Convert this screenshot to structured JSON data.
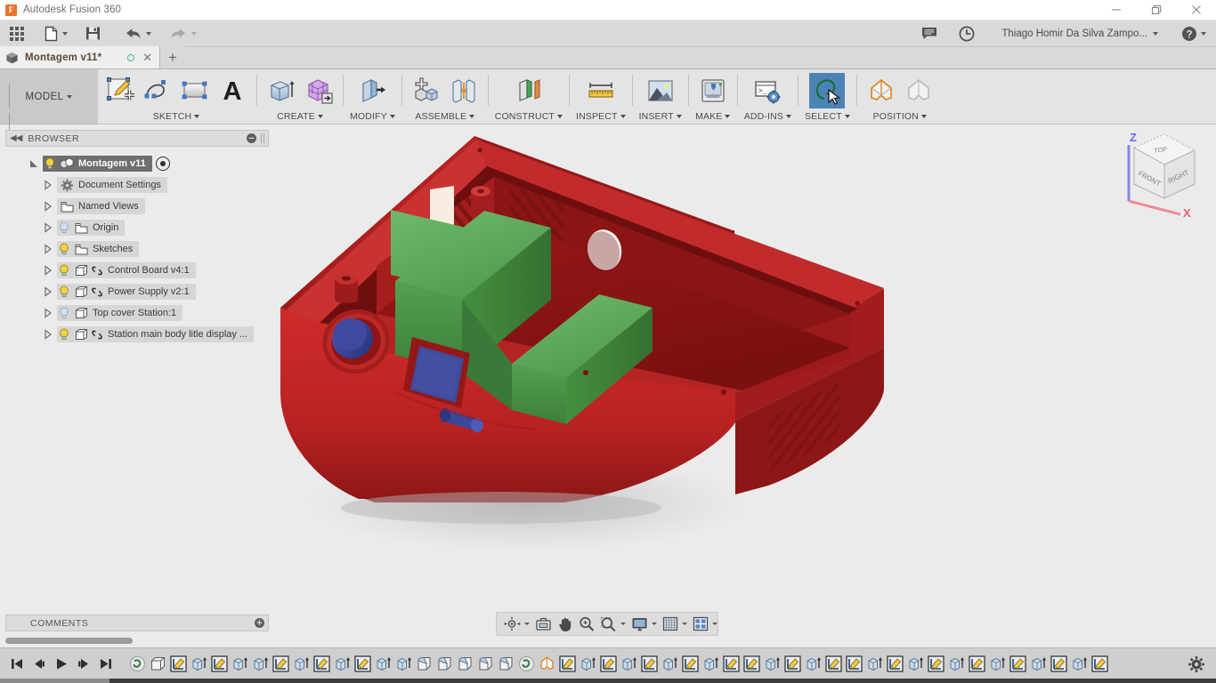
{
  "window": {
    "app_title": "Autodesk Fusion 360",
    "logo_letter": "F",
    "controls": {
      "minimize": "minimize-icon",
      "maximize": "restore-icon",
      "close": "close-icon"
    }
  },
  "quick_access": {
    "left_items": [
      {
        "name": "show-data-panel-button",
        "icon": "grid-icon",
        "label": "",
        "has_caret": false
      },
      {
        "name": "file-menu-button",
        "icon": "file-icon",
        "label": "",
        "has_caret": true
      },
      {
        "name": "save-button",
        "icon": "save-icon",
        "label": "",
        "has_caret": false
      },
      {
        "name": "undo-button",
        "icon": "undo-arrow-icon",
        "label": "",
        "has_caret": true
      },
      {
        "name": "redo-button",
        "icon": "redo-arrow-icon",
        "label": "",
        "has_caret": true
      }
    ],
    "right_items": [
      {
        "name": "comments-button",
        "icon": "speech-bubble-icon"
      },
      {
        "name": "job-status-button",
        "icon": "clock-icon"
      }
    ],
    "account_label": "Thiago Homir Da Silva Zampo...",
    "help_icon": "question-mark-icon"
  },
  "tabs": {
    "documents": [
      {
        "label": "Montagem v11*",
        "icon": "cube-icon",
        "modified_indicator": "circle",
        "close": "x",
        "active": true
      }
    ],
    "new_tab_label": "+"
  },
  "ribbon": {
    "workspace_label": "MODEL",
    "groups": [
      {
        "label": "SKETCH",
        "name": "ribbon-group-sketch",
        "tools": [
          {
            "name": "create-sketch-tool",
            "icon": "sketch-pencil-icon"
          },
          {
            "name": "spline-tool",
            "icon": "spline-curve-icon"
          },
          {
            "name": "rectangle-tool",
            "icon": "rectangle-icon"
          },
          {
            "name": "text-tool",
            "icon": "text-A-icon"
          }
        ]
      },
      {
        "label": "CREATE",
        "name": "ribbon-group-create",
        "tools": [
          {
            "name": "extrude-tool",
            "icon": "extrude-icon"
          },
          {
            "name": "create-form-tool",
            "icon": "form-mesh-icon"
          }
        ]
      },
      {
        "label": "MODIFY",
        "name": "ribbon-group-modify",
        "tools": [
          {
            "name": "press-pull-tool",
            "icon": "press-pull-icon"
          }
        ]
      },
      {
        "label": "ASSEMBLE",
        "name": "ribbon-group-assemble",
        "tools": [
          {
            "name": "new-component-tool",
            "icon": "new-component-icon"
          },
          {
            "name": "joint-tool",
            "icon": "joint-icon"
          }
        ]
      },
      {
        "label": "CONSTRUCT",
        "name": "ribbon-group-construct",
        "tools": [
          {
            "name": "offset-plane-tool",
            "icon": "offset-plane-icon"
          }
        ]
      },
      {
        "label": "INSPECT",
        "name": "ribbon-group-inspect",
        "tools": [
          {
            "name": "measure-tool",
            "icon": "ruler-icon"
          }
        ]
      },
      {
        "label": "INSERT",
        "name": "ribbon-group-insert",
        "tools": [
          {
            "name": "insert-mcmaster-tool",
            "icon": "picture-icon"
          }
        ]
      },
      {
        "label": "MAKE",
        "name": "ribbon-group-make",
        "tools": [
          {
            "name": "3d-print-tool",
            "icon": "3d-printer-icon"
          }
        ]
      },
      {
        "label": "ADD-INS",
        "name": "ribbon-group-addins",
        "tools": [
          {
            "name": "scripts-and-addins-tool",
            "icon": "console-gear-icon"
          }
        ]
      },
      {
        "label": "SELECT",
        "name": "ribbon-group-select",
        "tools": [
          {
            "name": "select-tool",
            "icon": "lasso-cursor-icon",
            "active": true
          }
        ]
      },
      {
        "label": "POSITION",
        "name": "ribbon-group-position",
        "tools": [
          {
            "name": "position-capture-tool",
            "icon": "position-orange-icon"
          },
          {
            "name": "position-revert-tool",
            "icon": "position-gray-icon"
          }
        ]
      }
    ]
  },
  "browser": {
    "panel_title": "BROWSER",
    "collapse_icon": "double-chevron-left-icon",
    "options_icon": "minus-circle-icon",
    "tree": [
      {
        "label": "Montagem v11",
        "depth": 0,
        "selected": true,
        "bulb": "on",
        "icon": "assembly-icon",
        "has_arrow": true,
        "arrow_open": true,
        "link": false,
        "radio": true
      },
      {
        "label": "Document Settings",
        "depth": 1,
        "selected": false,
        "bulb": "none",
        "icon": "gear-icon",
        "has_arrow": true,
        "arrow_open": false,
        "link": false,
        "radio": false
      },
      {
        "label": "Named Views",
        "depth": 1,
        "selected": false,
        "bulb": "none",
        "icon": "folder-icon",
        "has_arrow": true,
        "arrow_open": false,
        "link": false,
        "radio": false
      },
      {
        "label": "Origin",
        "depth": 1,
        "selected": false,
        "bulb": "off",
        "icon": "folder-icon",
        "has_arrow": true,
        "arrow_open": false,
        "link": false,
        "radio": false
      },
      {
        "label": "Sketches",
        "depth": 1,
        "selected": false,
        "bulb": "on",
        "icon": "folder-icon",
        "has_arrow": true,
        "arrow_open": false,
        "link": false,
        "radio": false
      },
      {
        "label": "Control Board v4:1",
        "depth": 1,
        "selected": false,
        "bulb": "on",
        "icon": "body-icon",
        "has_arrow": true,
        "arrow_open": false,
        "link": true,
        "radio": false
      },
      {
        "label": "Power Supply v2:1",
        "depth": 1,
        "selected": false,
        "bulb": "on",
        "icon": "body-icon",
        "has_arrow": true,
        "arrow_open": false,
        "link": true,
        "radio": false
      },
      {
        "label": "Top cover Station:1",
        "depth": 1,
        "selected": false,
        "bulb": "off",
        "icon": "body-icon",
        "has_arrow": true,
        "arrow_open": false,
        "link": false,
        "radio": false
      },
      {
        "label": "Station main body litle display ...",
        "depth": 1,
        "selected": false,
        "bulb": "on",
        "icon": "body-icon",
        "has_arrow": true,
        "arrow_open": false,
        "link": true,
        "radio": false
      }
    ]
  },
  "comments_panel": {
    "title": "COMMENTS",
    "add_icon": "plus-circle-icon"
  },
  "viewcube": {
    "faces": {
      "top": "TOP",
      "front": "FRONT",
      "right": "RIGHT"
    },
    "axes": {
      "z": "Z",
      "x": "X"
    },
    "axis_colors": {
      "z": "#7b7be8",
      "x": "#e87b8a"
    }
  },
  "viewport": {
    "background": "#ebebeb",
    "model_colors": {
      "enclosure_red": "#b21f1f",
      "board_green": "#4a9c4a",
      "display_blue": "#3a4a9e",
      "paper_white": "#f5ece0"
    },
    "model_description": "Red 3D-printed enclosure with green PCB boards and blue display"
  },
  "nav_bar": {
    "items": [
      {
        "name": "orbit-button",
        "icon": "orbit-icon",
        "caret": true
      },
      {
        "name": "look-at-button",
        "icon": "look-at-icon",
        "caret": false
      },
      {
        "name": "pan-button",
        "icon": "hand-pan-icon",
        "caret": false
      },
      {
        "name": "zoom-button",
        "icon": "zoom-magnifier-icon",
        "caret": false
      },
      {
        "name": "fit-button",
        "icon": "fit-window-icon",
        "caret": true
      },
      {
        "name": "display-settings-button",
        "icon": "monitor-icon",
        "caret": true
      },
      {
        "name": "grid-snaps-button",
        "icon": "grid-icon",
        "caret": true
      },
      {
        "name": "viewports-button",
        "icon": "viewports-icon",
        "caret": true
      }
    ]
  },
  "timeline": {
    "playback": [
      {
        "name": "timeline-go-start-button",
        "icon": "skip-start-icon"
      },
      {
        "name": "timeline-step-back-button",
        "icon": "step-back-icon"
      },
      {
        "name": "timeline-play-button",
        "icon": "play-icon"
      },
      {
        "name": "timeline-step-forward-button",
        "icon": "step-forward-icon"
      },
      {
        "name": "timeline-go-end-button",
        "icon": "skip-end-icon"
      }
    ],
    "features": [
      "joint-icon",
      "body-icon",
      "sketch-icon",
      "extrude-icon",
      "sketch-icon",
      "extrude-icon",
      "extrude-icon",
      "sketch-icon",
      "extrude-icon",
      "sketch-icon",
      "extrude-icon",
      "sketch-icon",
      "extrude-icon",
      "extrude-icon",
      "fillet-icon",
      "fillet-icon",
      "fillet-icon",
      "fillet-icon",
      "fillet-icon",
      "joint-icon",
      "position-icon",
      "sketch-icon",
      "extrude-icon",
      "sketch-icon",
      "extrude-icon",
      "sketch-icon",
      "extrude-icon",
      "sketch-icon",
      "extrude-icon",
      "sketch-icon",
      "sketch-icon",
      "extrude-icon",
      "sketch-icon",
      "extrude-icon",
      "sketch-icon",
      "sketch-icon",
      "extrude-icon",
      "sketch-icon",
      "extrude-icon",
      "sketch-icon",
      "extrude-icon",
      "sketch-icon",
      "extrude-icon",
      "sketch-icon",
      "extrude-icon",
      "sketch-icon",
      "extrude-icon",
      "sketch-icon"
    ],
    "settings_icon": "gear-icon",
    "progress_percent": 9
  }
}
